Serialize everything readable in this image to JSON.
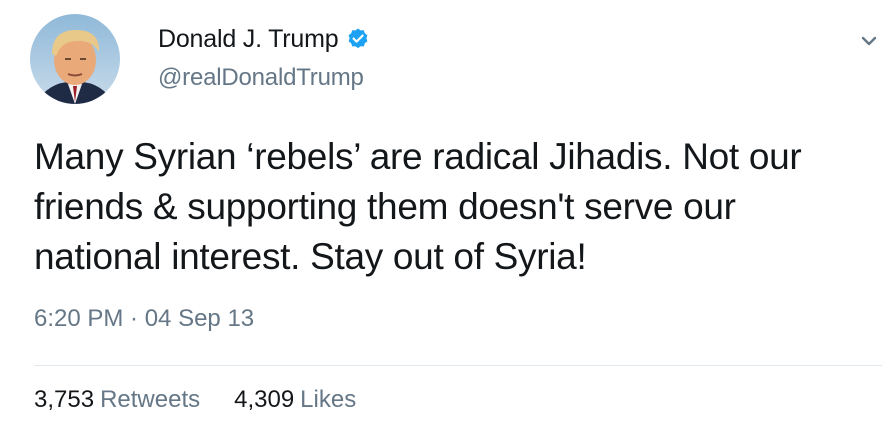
{
  "tweet": {
    "author": {
      "display_name": "Donald J. Trump",
      "handle": "@realDonaldTrump",
      "verified": true,
      "verified_icon": "verified-badge-icon",
      "avatar_icon": "profile-avatar"
    },
    "menu_icon": "chevron-down-icon",
    "text_lines": [
      "Many Syrian ‘rebels’ are radical Jihadis. Not our",
      "friends & supporting them doesn't serve our",
      "national interest. Stay out of Syria!"
    ],
    "timestamp": "6:20 PM · 04 Sep 13",
    "stats": {
      "retweets_count": "3,753",
      "retweets_label": "Retweets",
      "likes_count": "4,309",
      "likes_label": "Likes"
    }
  },
  "colors": {
    "text_primary": "#14171a",
    "text_secondary": "#657786",
    "verified_blue": "#1da1f2",
    "divider": "#e1e8ed"
  }
}
